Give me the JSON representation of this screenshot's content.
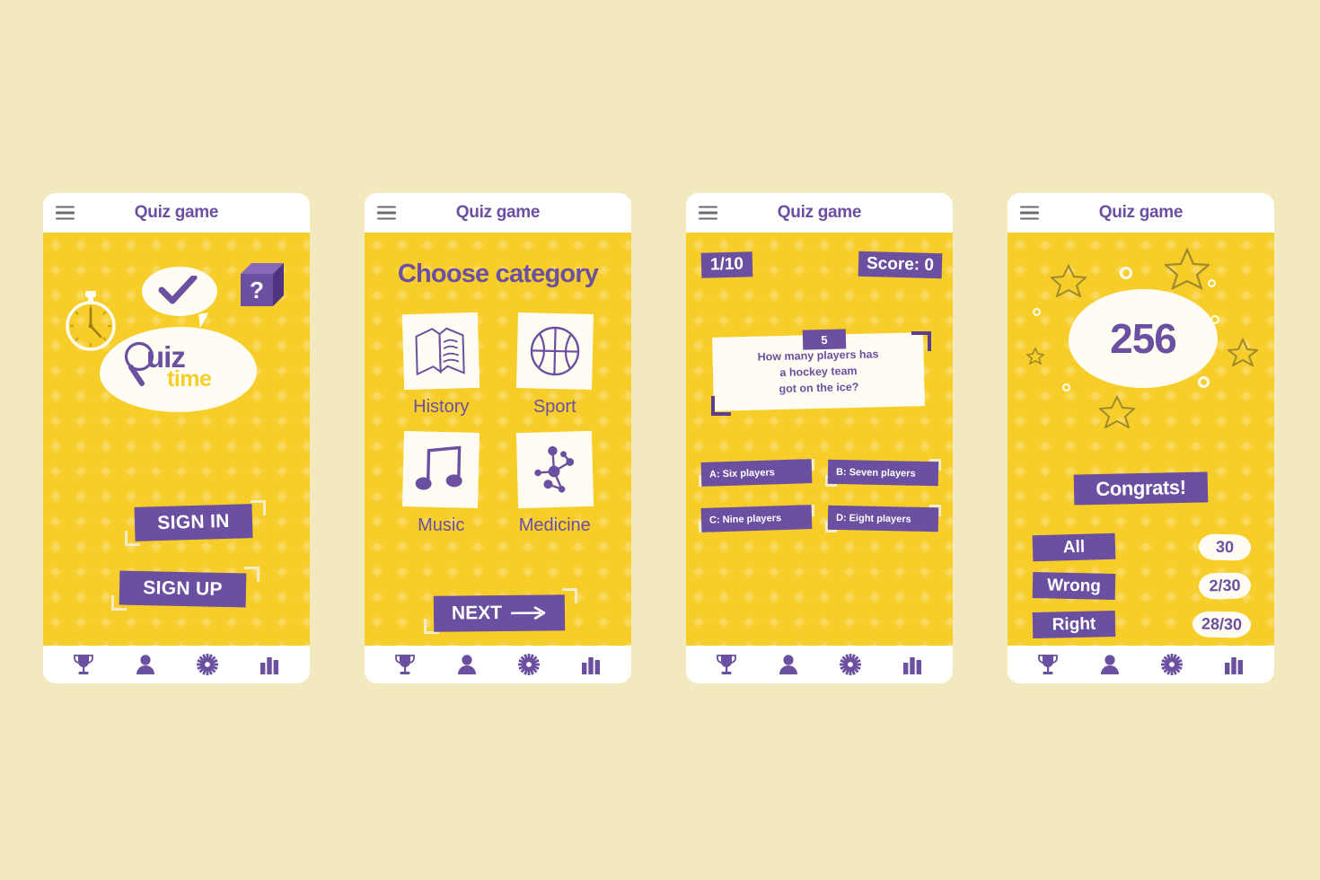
{
  "palette": {
    "canvas_bg": "#f2e9bf",
    "screen_yellow": "#f7cd2a",
    "purple": "#6b4fa0",
    "cream": "#fffdf3",
    "bracket": "#f4ecc8",
    "header_text": "#6b4fa0"
  },
  "common": {
    "header_title": "Quiz game",
    "menu_icon": "hamburger-menu-icon",
    "nav_items": [
      {
        "icon": "trophy-icon",
        "name": "trophy"
      },
      {
        "icon": "person-icon",
        "name": "profile"
      },
      {
        "icon": "gear-icon",
        "name": "settings"
      },
      {
        "icon": "bar-chart-icon",
        "name": "stats"
      }
    ]
  },
  "screen1": {
    "logo_primary": "uiz",
    "logo_secondary": "time",
    "decorations": [
      "stopwatch-icon",
      "speech-bubble-with-checkmark",
      "question-mark-cube",
      "magnifier-icon"
    ],
    "cube_glyph": "?",
    "sign_in_label": "SIGN IN",
    "sign_up_label": "SIGN UP"
  },
  "screen2": {
    "title": "Choose category",
    "categories": [
      {
        "label": "History",
        "icon": "open-book-icon"
      },
      {
        "label": "Sport",
        "icon": "basketball-icon"
      },
      {
        "label": "Music",
        "icon": "music-note-icon"
      },
      {
        "label": "Medicine",
        "icon": "molecule-icon"
      }
    ],
    "next_label": "NEXT",
    "next_arrow": "arrow-right-icon"
  },
  "screen3": {
    "progress": "1/10",
    "score": "Score: 0",
    "question_number": "5",
    "question_text": "How many players has a hockey team got on the ice?",
    "question_lines": [
      "How many players has",
      "a hockey team",
      "got on the ice?"
    ],
    "answers": [
      {
        "key": "A",
        "label": "A:  Six players"
      },
      {
        "key": "B",
        "label": "B: Seven players"
      },
      {
        "key": "C",
        "label": "C: Nine players"
      },
      {
        "key": "D",
        "label": "D:  Eight players"
      }
    ]
  },
  "screen4": {
    "score_value": "256",
    "congrats_label": "Congrats!",
    "stats": [
      {
        "label": "All",
        "value": "30"
      },
      {
        "label": "Wrong",
        "value": "2/30"
      },
      {
        "label": "Right",
        "value": "28/30"
      }
    ],
    "decorations": [
      "star-outline",
      "circle-outline"
    ]
  }
}
